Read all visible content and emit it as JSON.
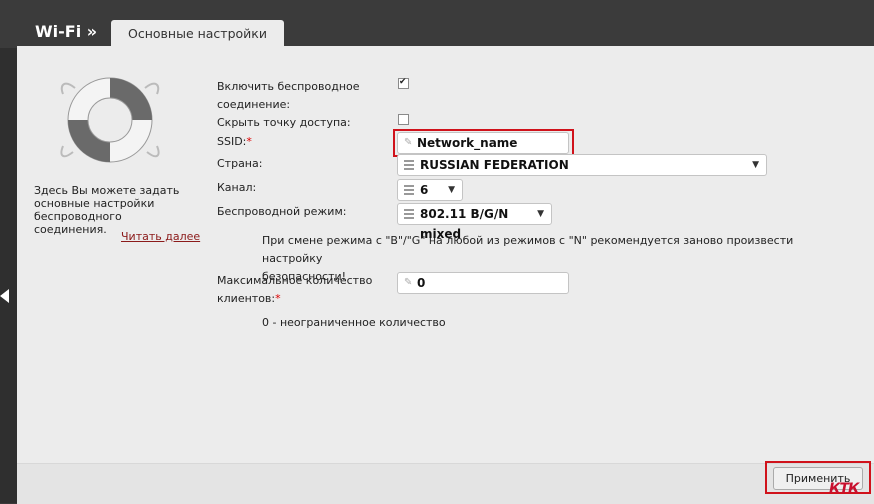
{
  "header": {
    "brand": "Wi-Fi »",
    "tab_label": "Основные настройки"
  },
  "sidebar": {
    "help_text": "Здесь Вы можете задать основные настройки беспроводного соединения.",
    "read_more": "Читать далее"
  },
  "form": {
    "enable_wireless": {
      "label_line1": "Включить беспроводное",
      "label_line2": "соединение:",
      "checked": true
    },
    "hide_ap": {
      "label": "Скрыть точку доступа:",
      "checked": false
    },
    "ssid": {
      "label": "SSID:",
      "required_mark": "*",
      "value": "Network_name"
    },
    "country": {
      "label": "Страна:",
      "value": "RUSSIAN FEDERATION"
    },
    "channel": {
      "label": "Канал:",
      "value": "6"
    },
    "mode": {
      "label": "Беспроводной режим:",
      "value": "802.11 B/G/N mixed"
    },
    "mode_note_line1": "При смене режима с \"B\"/\"G\" на любой из режимов с \"N\" рекомендуется заново произвести настройку",
    "mode_note_line2": "безопасности!",
    "max_clients": {
      "label_line1": "Максимальное количество",
      "label_line2": "клиентов:",
      "required_mark": "*",
      "value": "0"
    },
    "max_clients_note": "0 - неограниченное количество"
  },
  "footer": {
    "apply_label": "Применить"
  },
  "watermark": "КТК",
  "colors": {
    "accent_red": "#d0121b",
    "link": "#8b1a1a",
    "topbar": "#3b3b3b"
  }
}
